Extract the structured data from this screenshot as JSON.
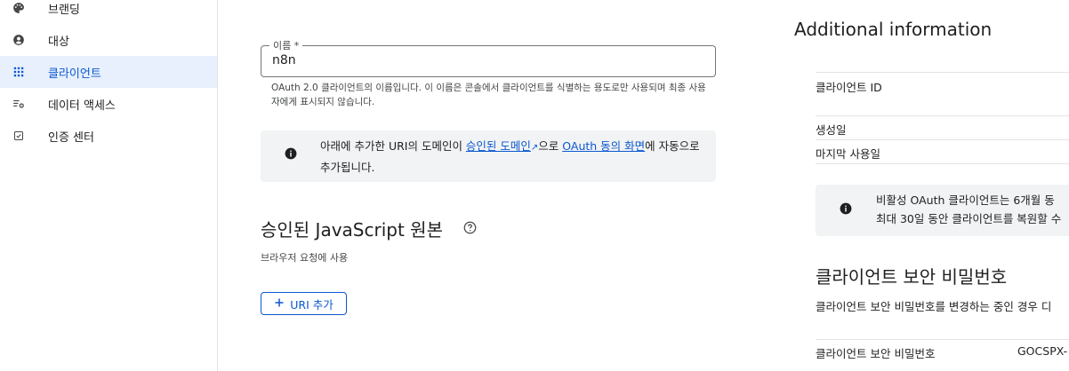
{
  "sidebar": {
    "items": [
      {
        "label": "브랜딩",
        "icon": "palette-icon",
        "active": false
      },
      {
        "label": "대상",
        "icon": "account-circle-icon",
        "active": false
      },
      {
        "label": "클라이언트",
        "icon": "grid-icon",
        "active": true
      },
      {
        "label": "데이터 액세스",
        "icon": "data-access-icon",
        "active": false
      },
      {
        "label": "인증 센터",
        "icon": "checkbox-icon",
        "active": false
      }
    ]
  },
  "form": {
    "name_label": "이름 *",
    "name_value": "n8n",
    "helper_text": "OAuth 2.0 클라이언트의 이름입니다. 이 이름은 콘솔에서 클라이언트를 식별하는 용도로만 사용되며 최종 사용자에게 표시되지 않습니다."
  },
  "info_box": {
    "text_1": "아래에 추가한 URI의 도메인이 ",
    "link_1": "승인된 도메인",
    "text_2": "으로 ",
    "link_2": "OAuth 동의 화면",
    "text_3": "에 자동으로 추가됩니다."
  },
  "origins": {
    "title": "승인된 JavaScript 원본",
    "subtitle": "브라우저 요청에 사용",
    "add_button": "URI 추가"
  },
  "additional": {
    "title": "Additional information",
    "client_id_label": "클라이언트 ID",
    "created_label": "생성일",
    "last_used_label": "마지막 사용일",
    "warning_line_1": "비활성 OAuth 클라이언트는 6개월 동",
    "warning_line_2": "최대 30일 동안 클라이언트를 복원할 수",
    "secret_title": "클라이언트 보안 비밀번호",
    "secret_desc": "클라이언트 보안 비밀번호를 변경하는 중인 경우 디",
    "secret_label": "클라이언트 보안 비밀번호",
    "secret_value": "GOCSPX-"
  },
  "colors": {
    "accent": "#0b57d0",
    "active_bg": "#e8f0fe",
    "info_bg": "#f1f3f4"
  }
}
